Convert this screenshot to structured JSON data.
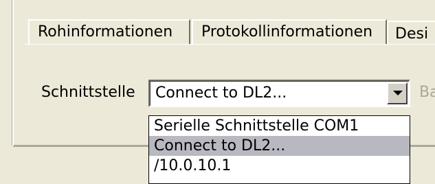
{
  "tabs": [
    {
      "label": "Rohinformationen"
    },
    {
      "label": "Protokollinformationen"
    },
    {
      "label": "Desi"
    }
  ],
  "interface": {
    "label": "Schnittstelle",
    "selected_value": "Connect to DL2...",
    "options": [
      {
        "label": "Serielle Schnittstelle COM1"
      },
      {
        "label": "Connect to DL2..."
      },
      {
        "label": "/10.0.10.1"
      }
    ],
    "highlighted_index": 1,
    "dropdown_icon": "chevron-down-icon"
  },
  "truncated_label": "Ba",
  "colors": {
    "window_background": "#ece9d8",
    "highlight": "#b8b8c0",
    "disabled_text": "#aca899"
  }
}
